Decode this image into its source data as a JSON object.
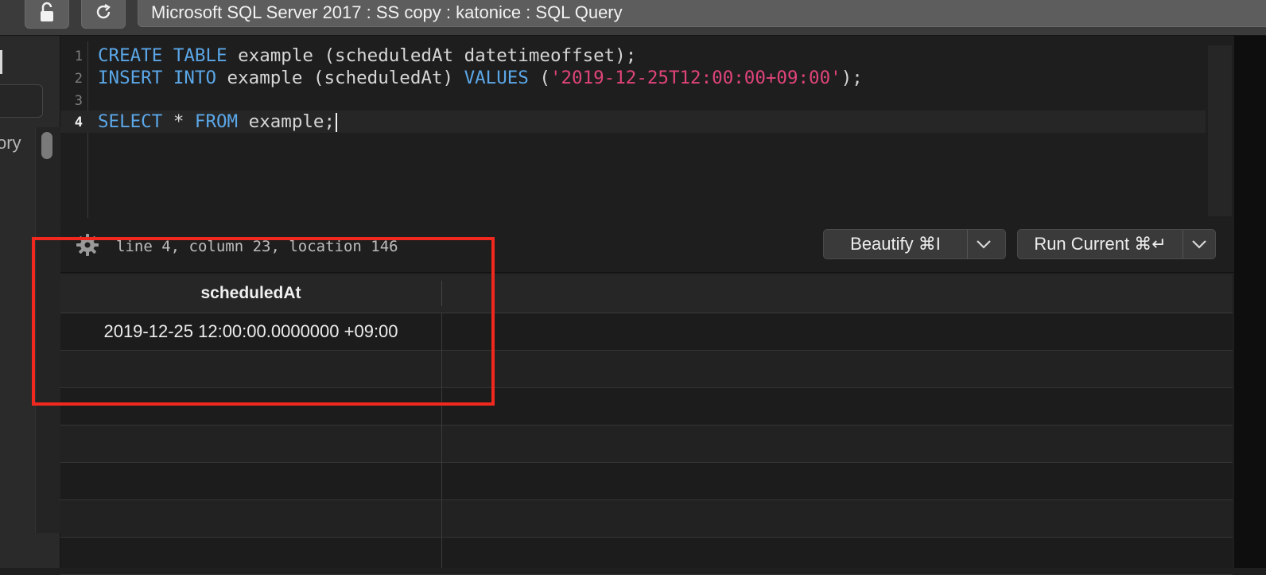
{
  "toolbar": {
    "title": "Microsoft SQL Server 2017 : SS copy : katonice : SQL Query",
    "lock_icon": "lock-icon",
    "refresh_icon": "refresh-icon"
  },
  "sidebar": {
    "label": "ory"
  },
  "editor": {
    "lines": [
      {
        "number": "1",
        "segments": [
          {
            "t": "CREATE",
            "k": "kw"
          },
          {
            "t": " "
          },
          {
            "t": "TABLE",
            "k": "kw"
          },
          {
            "t": " example (scheduledAt datetimeoffset);"
          }
        ]
      },
      {
        "number": "2",
        "segments": [
          {
            "t": "INSERT",
            "k": "kw"
          },
          {
            "t": " "
          },
          {
            "t": "INTO",
            "k": "kw"
          },
          {
            "t": " example (scheduledAt) "
          },
          {
            "t": "VALUES",
            "k": "kw"
          },
          {
            "t": " ("
          },
          {
            "t": "'2019-12-25T12:00:00+09:00'",
            "k": "str"
          },
          {
            "t": ");"
          }
        ]
      },
      {
        "number": "3",
        "segments": []
      },
      {
        "number": "4",
        "segments": [
          {
            "t": "SELECT",
            "k": "kw"
          },
          {
            "t": " * "
          },
          {
            "t": "FROM",
            "k": "kw"
          },
          {
            "t": " example;"
          }
        ]
      }
    ],
    "active_line": 4
  },
  "status": {
    "position_text": "line 4, column 23, location 146"
  },
  "buttons": {
    "beautify": "Beautify ⌘I",
    "run_current": "Run Current ⌘↵"
  },
  "results": {
    "columns": [
      "scheduledAt"
    ],
    "rows": [
      [
        "2019-12-25 12:00:00.0000000 +09:00"
      ]
    ]
  },
  "colors": {
    "keyword": "#5ba7e8",
    "string": "#e0447a",
    "annotation": "#f0281e"
  }
}
